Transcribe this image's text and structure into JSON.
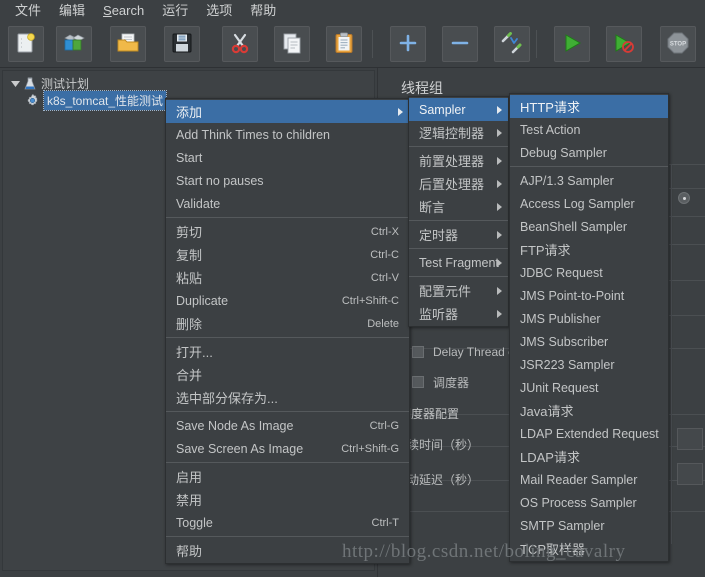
{
  "menubar": {
    "items": [
      {
        "label": "文件",
        "name": "menubar-file"
      },
      {
        "label": "编辑",
        "name": "menubar-edit"
      },
      {
        "label": "Search",
        "name": "menubar-search"
      },
      {
        "label": "运行",
        "name": "menubar-run"
      },
      {
        "label": "选项",
        "name": "menubar-options"
      },
      {
        "label": "帮助",
        "name": "menubar-help"
      }
    ]
  },
  "toolbar": {
    "buttons": [
      {
        "icon": "new-document-icon",
        "name": "toolbar-new"
      },
      {
        "icon": "templates-icon",
        "name": "toolbar-templates"
      },
      {
        "icon": "open-folder-icon",
        "name": "toolbar-open"
      },
      {
        "icon": "save-floppy-icon",
        "name": "toolbar-save"
      },
      {
        "icon": "cut-scissors-icon",
        "name": "toolbar-cut"
      },
      {
        "icon": "copy-icon",
        "name": "toolbar-copy"
      },
      {
        "icon": "paste-clipboard-icon",
        "name": "toolbar-paste"
      },
      {
        "icon": "plus-icon",
        "name": "toolbar-expand-all"
      },
      {
        "icon": "minus-icon",
        "name": "toolbar-collapse-all"
      },
      {
        "icon": "toggle-icon",
        "name": "toolbar-toggle"
      },
      {
        "icon": "start-play-icon",
        "name": "toolbar-start"
      },
      {
        "icon": "start-no-pauses-icon",
        "name": "toolbar-start-no-pauses"
      },
      {
        "icon": "stop-icon",
        "name": "toolbar-stop"
      }
    ]
  },
  "tree": {
    "root": {
      "label": "测试计划",
      "icon": "test-plan-icon",
      "expanded": true
    },
    "child": {
      "label": "k8s_tomcat_性能测试",
      "icon": "thread-group-gear-icon",
      "selected": true
    }
  },
  "right_panel": {
    "title": "线程组",
    "checkbox_delay_thread": "Delay Thread creation until needed",
    "checkbox_scheduler": "调度器",
    "scheduler_group_title": "调度器配置",
    "field_duration_label": "持续时间（秒）",
    "field_startup_delay_label": "启动延迟（秒）"
  },
  "context_menu": {
    "items": [
      {
        "label": "添加",
        "accel": "",
        "submenu": true,
        "selected": true,
        "cn": true,
        "name": "menu-item-add"
      },
      {
        "label": "Add Think Times to children",
        "accel": "",
        "submenu": false,
        "selected": false,
        "cn": false,
        "name": "menu-item-add-think-times"
      },
      {
        "label": "Start",
        "accel": "",
        "submenu": false,
        "selected": false,
        "cn": false,
        "name": "menu-item-start"
      },
      {
        "label": "Start no pauses",
        "accel": "",
        "submenu": false,
        "selected": false,
        "cn": false,
        "name": "menu-item-start-no-pauses"
      },
      {
        "label": "Validate",
        "accel": "",
        "submenu": false,
        "selected": false,
        "cn": false,
        "name": "menu-item-validate"
      },
      {
        "separator": true
      },
      {
        "label": "剪切",
        "accel": "Ctrl-X",
        "submenu": false,
        "selected": false,
        "cn": true,
        "name": "menu-item-cut"
      },
      {
        "label": "复制",
        "accel": "Ctrl-C",
        "submenu": false,
        "selected": false,
        "cn": true,
        "name": "menu-item-copy"
      },
      {
        "label": "粘贴",
        "accel": "Ctrl-V",
        "submenu": false,
        "selected": false,
        "cn": true,
        "name": "menu-item-paste"
      },
      {
        "label": "Duplicate",
        "accel": "Ctrl+Shift-C",
        "submenu": false,
        "selected": false,
        "cn": false,
        "name": "menu-item-duplicate"
      },
      {
        "label": "删除",
        "accel": "Delete",
        "submenu": false,
        "selected": false,
        "cn": true,
        "name": "menu-item-delete"
      },
      {
        "separator": true
      },
      {
        "label": "打开...",
        "accel": "",
        "submenu": false,
        "selected": false,
        "cn": true,
        "name": "menu-item-open"
      },
      {
        "label": "合并",
        "accel": "",
        "submenu": false,
        "selected": false,
        "cn": true,
        "name": "menu-item-merge"
      },
      {
        "label": "选中部分保存为...",
        "accel": "",
        "submenu": false,
        "selected": false,
        "cn": true,
        "name": "menu-item-save-selection-as"
      },
      {
        "separator": true
      },
      {
        "label": "Save Node As Image",
        "accel": "Ctrl-G",
        "submenu": false,
        "selected": false,
        "cn": false,
        "name": "menu-item-save-node-as-image"
      },
      {
        "label": "Save Screen As Image",
        "accel": "Ctrl+Shift-G",
        "submenu": false,
        "selected": false,
        "cn": false,
        "name": "menu-item-save-screen-as-image"
      },
      {
        "separator": true
      },
      {
        "label": "启用",
        "accel": "",
        "submenu": false,
        "selected": false,
        "cn": true,
        "name": "menu-item-enable"
      },
      {
        "label": "禁用",
        "accel": "",
        "submenu": false,
        "selected": false,
        "cn": true,
        "name": "menu-item-disable"
      },
      {
        "label": "Toggle",
        "accel": "Ctrl-T",
        "submenu": false,
        "selected": false,
        "cn": false,
        "name": "menu-item-toggle"
      },
      {
        "separator": true
      },
      {
        "label": "帮助",
        "accel": "",
        "submenu": false,
        "selected": false,
        "cn": true,
        "name": "menu-item-help"
      }
    ]
  },
  "add_submenu": {
    "items": [
      {
        "label": "Sampler",
        "submenu": true,
        "selected": true,
        "cn": false,
        "name": "submenu-item-sampler"
      },
      {
        "label": "逻辑控制器",
        "submenu": true,
        "selected": false,
        "cn": true,
        "name": "submenu-item-logic-controller"
      },
      {
        "separator": true
      },
      {
        "label": "前置处理器",
        "submenu": true,
        "selected": false,
        "cn": true,
        "name": "submenu-item-pre-processor"
      },
      {
        "label": "后置处理器",
        "submenu": true,
        "selected": false,
        "cn": true,
        "name": "submenu-item-post-processor"
      },
      {
        "label": "断言",
        "submenu": true,
        "selected": false,
        "cn": true,
        "name": "submenu-item-assertion"
      },
      {
        "separator": true
      },
      {
        "label": "定时器",
        "submenu": true,
        "selected": false,
        "cn": true,
        "name": "submenu-item-timer"
      },
      {
        "separator": true
      },
      {
        "label": "Test Fragment",
        "submenu": true,
        "selected": false,
        "cn": false,
        "name": "submenu-item-test-fragment"
      },
      {
        "separator": true
      },
      {
        "label": "配置元件",
        "submenu": true,
        "selected": false,
        "cn": true,
        "name": "submenu-item-config-element"
      },
      {
        "label": "监听器",
        "submenu": true,
        "selected": false,
        "cn": true,
        "name": "submenu-item-listener"
      }
    ]
  },
  "sampler_submenu": {
    "items": [
      {
        "label": "HTTP请求",
        "selected": true,
        "cn": true,
        "name": "sampler-item-http-request"
      },
      {
        "label": "Test Action",
        "selected": false,
        "cn": false,
        "name": "sampler-item-test-action"
      },
      {
        "label": "Debug Sampler",
        "selected": false,
        "cn": false,
        "name": "sampler-item-debug-sampler"
      },
      {
        "separator": true
      },
      {
        "label": "AJP/1.3 Sampler",
        "selected": false,
        "cn": false,
        "name": "sampler-item-ajp13-sampler"
      },
      {
        "label": "Access Log Sampler",
        "selected": false,
        "cn": false,
        "name": "sampler-item-access-log-sampler"
      },
      {
        "label": "BeanShell Sampler",
        "selected": false,
        "cn": false,
        "name": "sampler-item-beanshell-sampler"
      },
      {
        "label": "FTP请求",
        "selected": false,
        "cn": true,
        "name": "sampler-item-ftp-request"
      },
      {
        "label": "JDBC Request",
        "selected": false,
        "cn": false,
        "name": "sampler-item-jdbc-request"
      },
      {
        "label": "JMS Point-to-Point",
        "selected": false,
        "cn": false,
        "name": "sampler-item-jms-point-to-point"
      },
      {
        "label": "JMS Publisher",
        "selected": false,
        "cn": false,
        "name": "sampler-item-jms-publisher"
      },
      {
        "label": "JMS Subscriber",
        "selected": false,
        "cn": false,
        "name": "sampler-item-jms-subscriber"
      },
      {
        "label": "JSR223 Sampler",
        "selected": false,
        "cn": false,
        "name": "sampler-item-jsr223-sampler"
      },
      {
        "label": "JUnit Request",
        "selected": false,
        "cn": false,
        "name": "sampler-item-junit-request"
      },
      {
        "label": "Java请求",
        "selected": false,
        "cn": true,
        "name": "sampler-item-java-request"
      },
      {
        "label": "LDAP Extended Request",
        "selected": false,
        "cn": false,
        "name": "sampler-item-ldap-extended-request"
      },
      {
        "label": "LDAP请求",
        "selected": false,
        "cn": true,
        "name": "sampler-item-ldap-request"
      },
      {
        "label": "Mail Reader Sampler",
        "selected": false,
        "cn": false,
        "name": "sampler-item-mail-reader-sampler"
      },
      {
        "label": "OS Process Sampler",
        "selected": false,
        "cn": false,
        "name": "sampler-item-os-process-sampler"
      },
      {
        "label": "SMTP Sampler",
        "selected": false,
        "cn": false,
        "name": "sampler-item-smtp-sampler"
      },
      {
        "label": "TCP取样器",
        "selected": false,
        "cn": true,
        "name": "sampler-item-tcp-sampler"
      }
    ]
  },
  "watermark": {
    "text": "http://blog.csdn.net/boling_cavalry"
  },
  "colors": {
    "window_bg": "#3c4043",
    "menu_bg": "#3c4043",
    "selection_blue": "#3b6ea5",
    "text": "#c3c5c6"
  }
}
